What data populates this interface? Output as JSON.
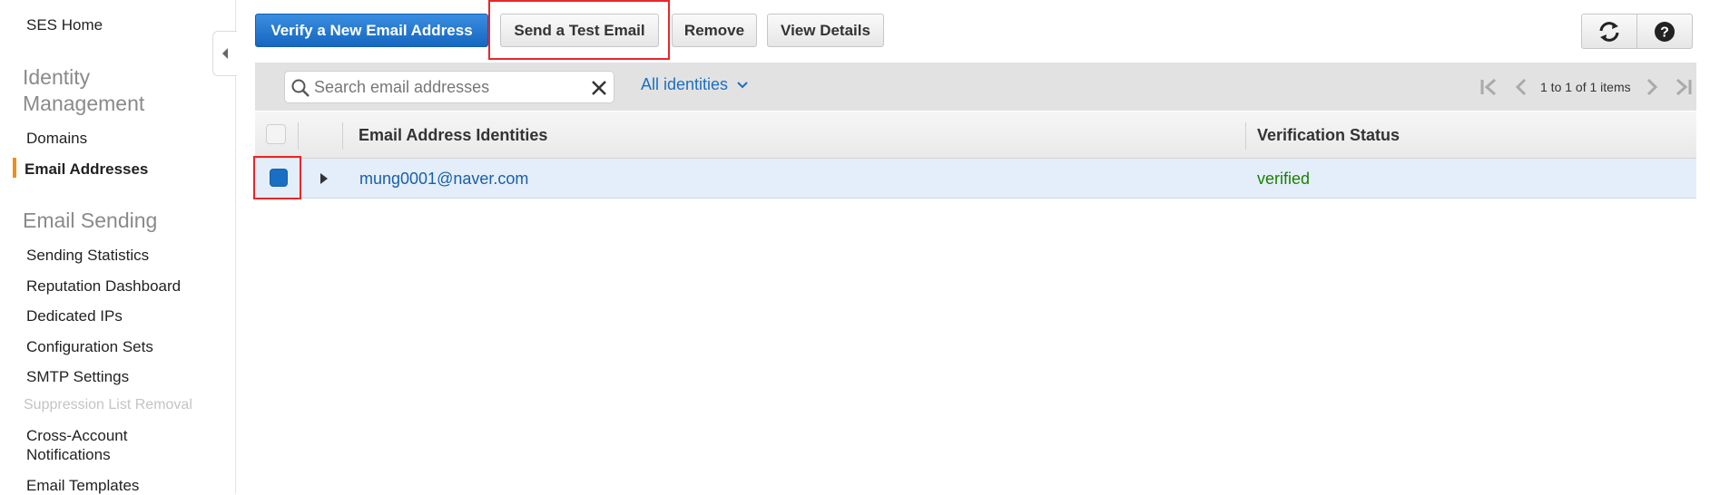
{
  "sidebar": {
    "home": "SES Home",
    "sections": [
      {
        "title": "Identity Management",
        "title_line1": "Identity",
        "title_line2": "Management"
      },
      {
        "title": "Email Sending"
      }
    ],
    "identity_items": [
      {
        "label": "Domains"
      },
      {
        "label": "Email Addresses",
        "active": true
      }
    ],
    "sending_items": [
      {
        "label": "Sending Statistics"
      },
      {
        "label": "Reputation Dashboard"
      },
      {
        "label": "Dedicated IPs"
      },
      {
        "label": "Configuration Sets"
      },
      {
        "label": "SMTP Settings"
      },
      {
        "label": "Suppression List Removal",
        "disabled": true
      },
      {
        "label": "Cross-Account Notifications",
        "line1": "Cross-Account",
        "line2": "Notifications"
      },
      {
        "label": "Email Templates"
      }
    ]
  },
  "toolbar": {
    "verify_label": "Verify a New Email Address",
    "send_test_label": "Send a Test Email",
    "remove_label": "Remove",
    "view_details_label": "View Details",
    "refresh_icon": "refresh-icon",
    "help_icon": "help-icon"
  },
  "filter": {
    "search_placeholder": "Search email addresses",
    "search_value": "",
    "identity_filter": "All identities",
    "pagination_text": "1 to 1 of 1 items"
  },
  "table": {
    "columns": [
      "Email Address Identities",
      "Verification Status"
    ],
    "rows": [
      {
        "email": "mung0001@naver.com",
        "status": "verified",
        "selected": true
      }
    ]
  },
  "colors": {
    "primary": "#1a6fc4",
    "active_nav": "#f08c1c",
    "verified": "#1d8102",
    "highlight": "#e8262b",
    "selected_row": "#e3eefa"
  }
}
